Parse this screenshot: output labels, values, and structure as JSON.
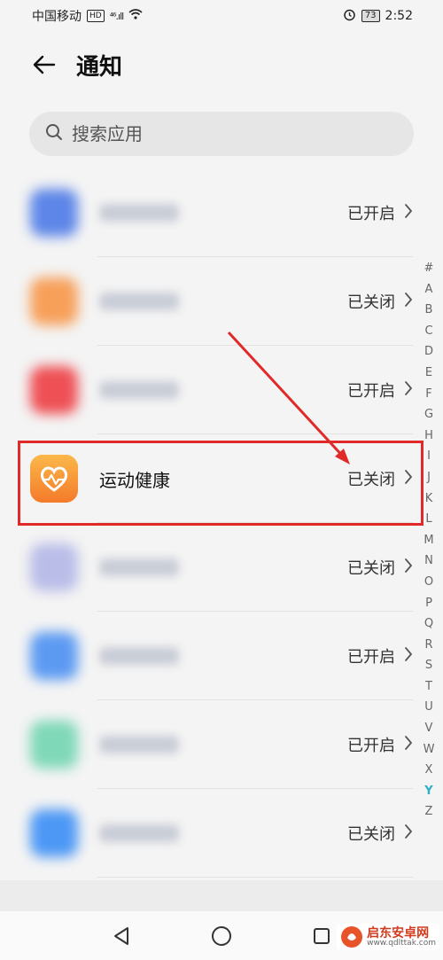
{
  "status_bar": {
    "carrier": "中国移动",
    "hd_badge": "HD",
    "signal": "⁴⁶.ıll",
    "battery": "73",
    "time": "2:52"
  },
  "header": {
    "title": "通知"
  },
  "search": {
    "placeholder": "搜索应用"
  },
  "apps": [
    {
      "name": "",
      "status": "已开启",
      "icon_color": "#5d86e8",
      "blurred": true
    },
    {
      "name": "",
      "status": "已关闭",
      "icon_color": "#f7a05a",
      "blurred": true
    },
    {
      "name": "",
      "status": "已开启",
      "icon_color": "#ee5055",
      "blurred": true
    },
    {
      "name": "运动健康",
      "status": "已关闭",
      "icon_color": "#f79a34",
      "blurred": false
    },
    {
      "name": "",
      "status": "已关闭",
      "icon_color": "#b9bde8",
      "blurred": true
    },
    {
      "name": "",
      "status": "已开启",
      "icon_color": "#5c9af2",
      "blurred": true
    },
    {
      "name": "",
      "status": "已开启",
      "icon_color": "#7fd8b8",
      "blurred": true
    },
    {
      "name": "",
      "status": "已关闭",
      "icon_color": "#4d98f5",
      "blurred": true
    }
  ],
  "alpha_index": [
    "#",
    "A",
    "B",
    "C",
    "D",
    "E",
    "F",
    "G",
    "H",
    "I",
    "J",
    "K",
    "L",
    "M",
    "N",
    "O",
    "P",
    "Q",
    "R",
    "S",
    "T",
    "U",
    "V",
    "W",
    "X",
    "Y",
    "Z"
  ],
  "alpha_active": "Y",
  "accent_color": "#e02a2a",
  "watermark": {
    "title": "启东安卓网",
    "url": "www.qdlttak.com"
  }
}
